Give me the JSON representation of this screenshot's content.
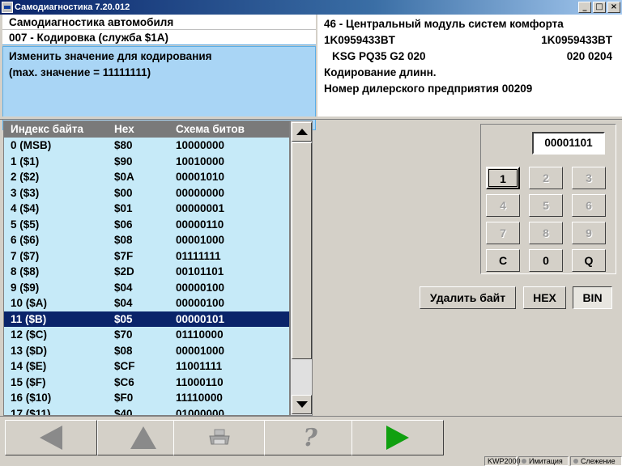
{
  "window": {
    "title": "Самодиагностика 7.20.012",
    "controls": [
      "_",
      "□",
      "×"
    ]
  },
  "header_left": {
    "line1": "Самодиагностика автомобиля",
    "line2": "007 - Кодировка (служба $1A)",
    "prompt1": "Изменить значение для кодирования",
    "prompt2": "(max. значение = 11111111)"
  },
  "header_right": {
    "module": "46 - Центральный модуль систем комфорта",
    "part_left": "1K0959433BT",
    "part_right": "1K0959433BT",
    "component": "KSG PQ35 G2  020",
    "component_right": "020  0204",
    "coding": "Кодирование длинн.",
    "dealer": "Номер дилерского предприятия 00209"
  },
  "table": {
    "headers": [
      "Индекс байта",
      "Hex",
      "Схема битов"
    ],
    "rows": [
      [
        "0  (MSB)",
        "$80",
        "10000000"
      ],
      [
        "1  ($1)",
        "$90",
        "10010000"
      ],
      [
        "2  ($2)",
        "$0A",
        "00001010"
      ],
      [
        "3  ($3)",
        "$00",
        "00000000"
      ],
      [
        "4  ($4)",
        "$01",
        "00000001"
      ],
      [
        "5  ($5)",
        "$06",
        "00000110"
      ],
      [
        "6  ($6)",
        "$08",
        "00001000"
      ],
      [
        "7  ($7)",
        "$7F",
        "01111111"
      ],
      [
        "8  ($8)",
        "$2D",
        "00101101"
      ],
      [
        "9  ($9)",
        "$04",
        "00000100"
      ],
      [
        "10  ($A)",
        "$04",
        "00000100"
      ],
      [
        "11  ($B)",
        "$05",
        "00000101"
      ],
      [
        "12  ($C)",
        "$70",
        "01110000"
      ],
      [
        "13  ($D)",
        "$08",
        "00001000"
      ],
      [
        "14  ($E)",
        "$CF",
        "11001111"
      ],
      [
        "15  ($F)",
        "$C6",
        "11000110"
      ],
      [
        "16  ($10)",
        "$F0",
        "11110000"
      ],
      [
        "17  ($11)",
        "$40",
        "01000000"
      ]
    ],
    "selected_index": 11
  },
  "keypad": {
    "display": "00001101",
    "keys": [
      "1",
      "2",
      "3",
      "4",
      "5",
      "6",
      "7",
      "8",
      "9",
      "C",
      "0",
      "Q"
    ],
    "delete_byte": "Удалить байт",
    "hex": "HEX",
    "bin": "BIN"
  },
  "statusbar": {
    "protocol": "KWP2000",
    "sim": "Имитация",
    "trace": "Слежение"
  }
}
